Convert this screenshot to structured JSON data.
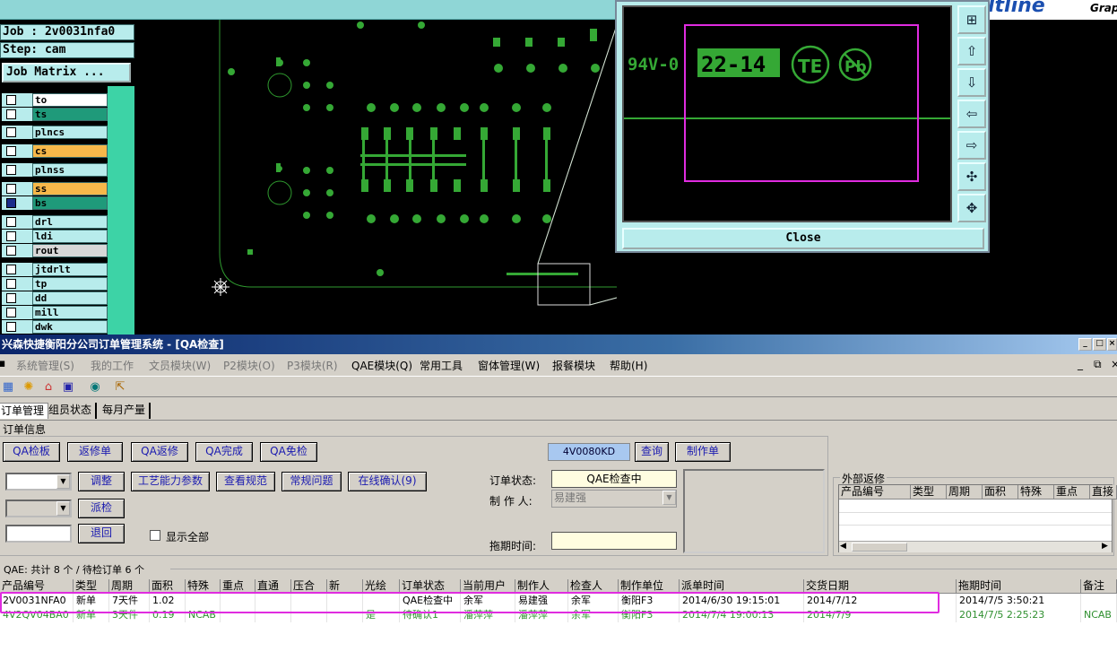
{
  "cam": {
    "brand": "ltline",
    "brand_sub": "Grap",
    "job_label": "Job : 2v0031nfa0",
    "step_label": "Step: cam",
    "job_matrix_button": "Job Matrix ...",
    "layers": [
      {
        "name": "to",
        "color": "#ffffff",
        "checked": false
      },
      {
        "name": "ts",
        "color": "#1f9a7a",
        "checked": false
      },
      {
        "name": "plncs",
        "color": "#b8ecec",
        "checked": false
      },
      {
        "name": "cs",
        "color": "#f7b84a",
        "checked": false
      },
      {
        "name": "plnss",
        "color": "#b8ecec",
        "checked": false
      },
      {
        "name": "ss",
        "color": "#f7b84a",
        "checked": false
      },
      {
        "name": "bs",
        "color": "#1f9a7a",
        "checked": true
      },
      {
        "name": "drl",
        "color": "#b8ecec",
        "checked": false
      },
      {
        "name": "ldi",
        "color": "#b8ecec",
        "checked": false
      },
      {
        "name": "rout",
        "color": "#d8d8d8",
        "checked": false
      },
      {
        "name": "jtdrlt",
        "color": "#b8ecec",
        "checked": false
      },
      {
        "name": "tp",
        "color": "#b8ecec",
        "checked": false
      },
      {
        "name": "dd",
        "color": "#b8ecec",
        "checked": false
      },
      {
        "name": "mill",
        "color": "#b8ecec",
        "checked": false
      },
      {
        "name": "dwk",
        "color": "#b8ecec",
        "checked": false
      }
    ],
    "zoom_text": {
      "ul": "94V-0",
      "date": "22-14",
      "te": "TE",
      "pb": "Pb"
    },
    "close_label": "Close"
  },
  "erp": {
    "window_title": "兴森快捷衡阳分公司订单管理系统 - [QA检查]",
    "menus": [
      "系统管理(S)",
      "我的工作",
      "文员模块(W)",
      "P2模块(O)",
      "P3模块(R)",
      "QAE模块(Q)",
      "常用工具",
      "窗体管理(W)",
      "报餐模块",
      "帮助(H)"
    ],
    "tabs": [
      "订单管理",
      "组员状态",
      "每月产量"
    ],
    "section_title": "订单信息",
    "action_buttons": [
      "QA检板",
      "返修单",
      "QA返修",
      "QA完成",
      "QA免检"
    ],
    "order_code": "4V0080KD",
    "query_button": "查询",
    "make_order_button": "制作单",
    "tool_buttons": [
      "调整",
      "工艺能力参数",
      "查看规范",
      "常规问题",
      "在线确认(9)"
    ],
    "dispatch_button": "派检",
    "return_button": "退回",
    "show_all_label": "显示全部",
    "status_label": "订单状态:",
    "status_value": "QAE检查中",
    "maker_label": "制 作 人:",
    "maker_value": "易建强",
    "delay_label": "拖期时间:",
    "external_group": "外部返修",
    "ext_columns": [
      "产品编号",
      "类型",
      "周期",
      "面积",
      "特殊",
      "重点",
      "直接"
    ],
    "summary": "QAE: 共计 8 个 / 待检订单 6 个",
    "columns": [
      "产品编号",
      "类型",
      "周期",
      "面积",
      "特殊",
      "重点",
      "直通",
      "压合",
      "新",
      "光绘",
      "订单状态",
      "当前用户",
      "制作人",
      "检查人",
      "制作单位",
      "派单时间",
      "交货日期",
      "拖期时间",
      "备注"
    ],
    "rows": [
      {
        "code": "2V0031NFA0",
        "type": "新单",
        "cycle": "7天件",
        "area": "1.02",
        "special": "",
        "key": "",
        "direct": "",
        "press": "",
        "new": "",
        "photo": "",
        "status": "QAE检查中",
        "user": "余军",
        "maker": "易建强",
        "checker": "余军",
        "unit": "衡阳F3",
        "dispatch": "2014/6/30 19:15:01",
        "delivery": "2014/7/12",
        "delay": "2014/7/5 3:50:21",
        "note": ""
      },
      {
        "code": "4V2QV04BA0",
        "type": "新单",
        "cycle": "3天件",
        "area": "0.19",
        "special": "NCAB",
        "key": "",
        "direct": "",
        "press": "",
        "new": "",
        "photo": "是",
        "status": "待确认1",
        "user": "潘萍萍",
        "maker": "潘萍萍",
        "checker": "余军",
        "unit": "衡阳F3",
        "dispatch": "2014/7/4 19:00:13",
        "delivery": "2014/7/9",
        "delay": "2014/7/5 2:25:23",
        "note": "NCAB"
      }
    ]
  }
}
